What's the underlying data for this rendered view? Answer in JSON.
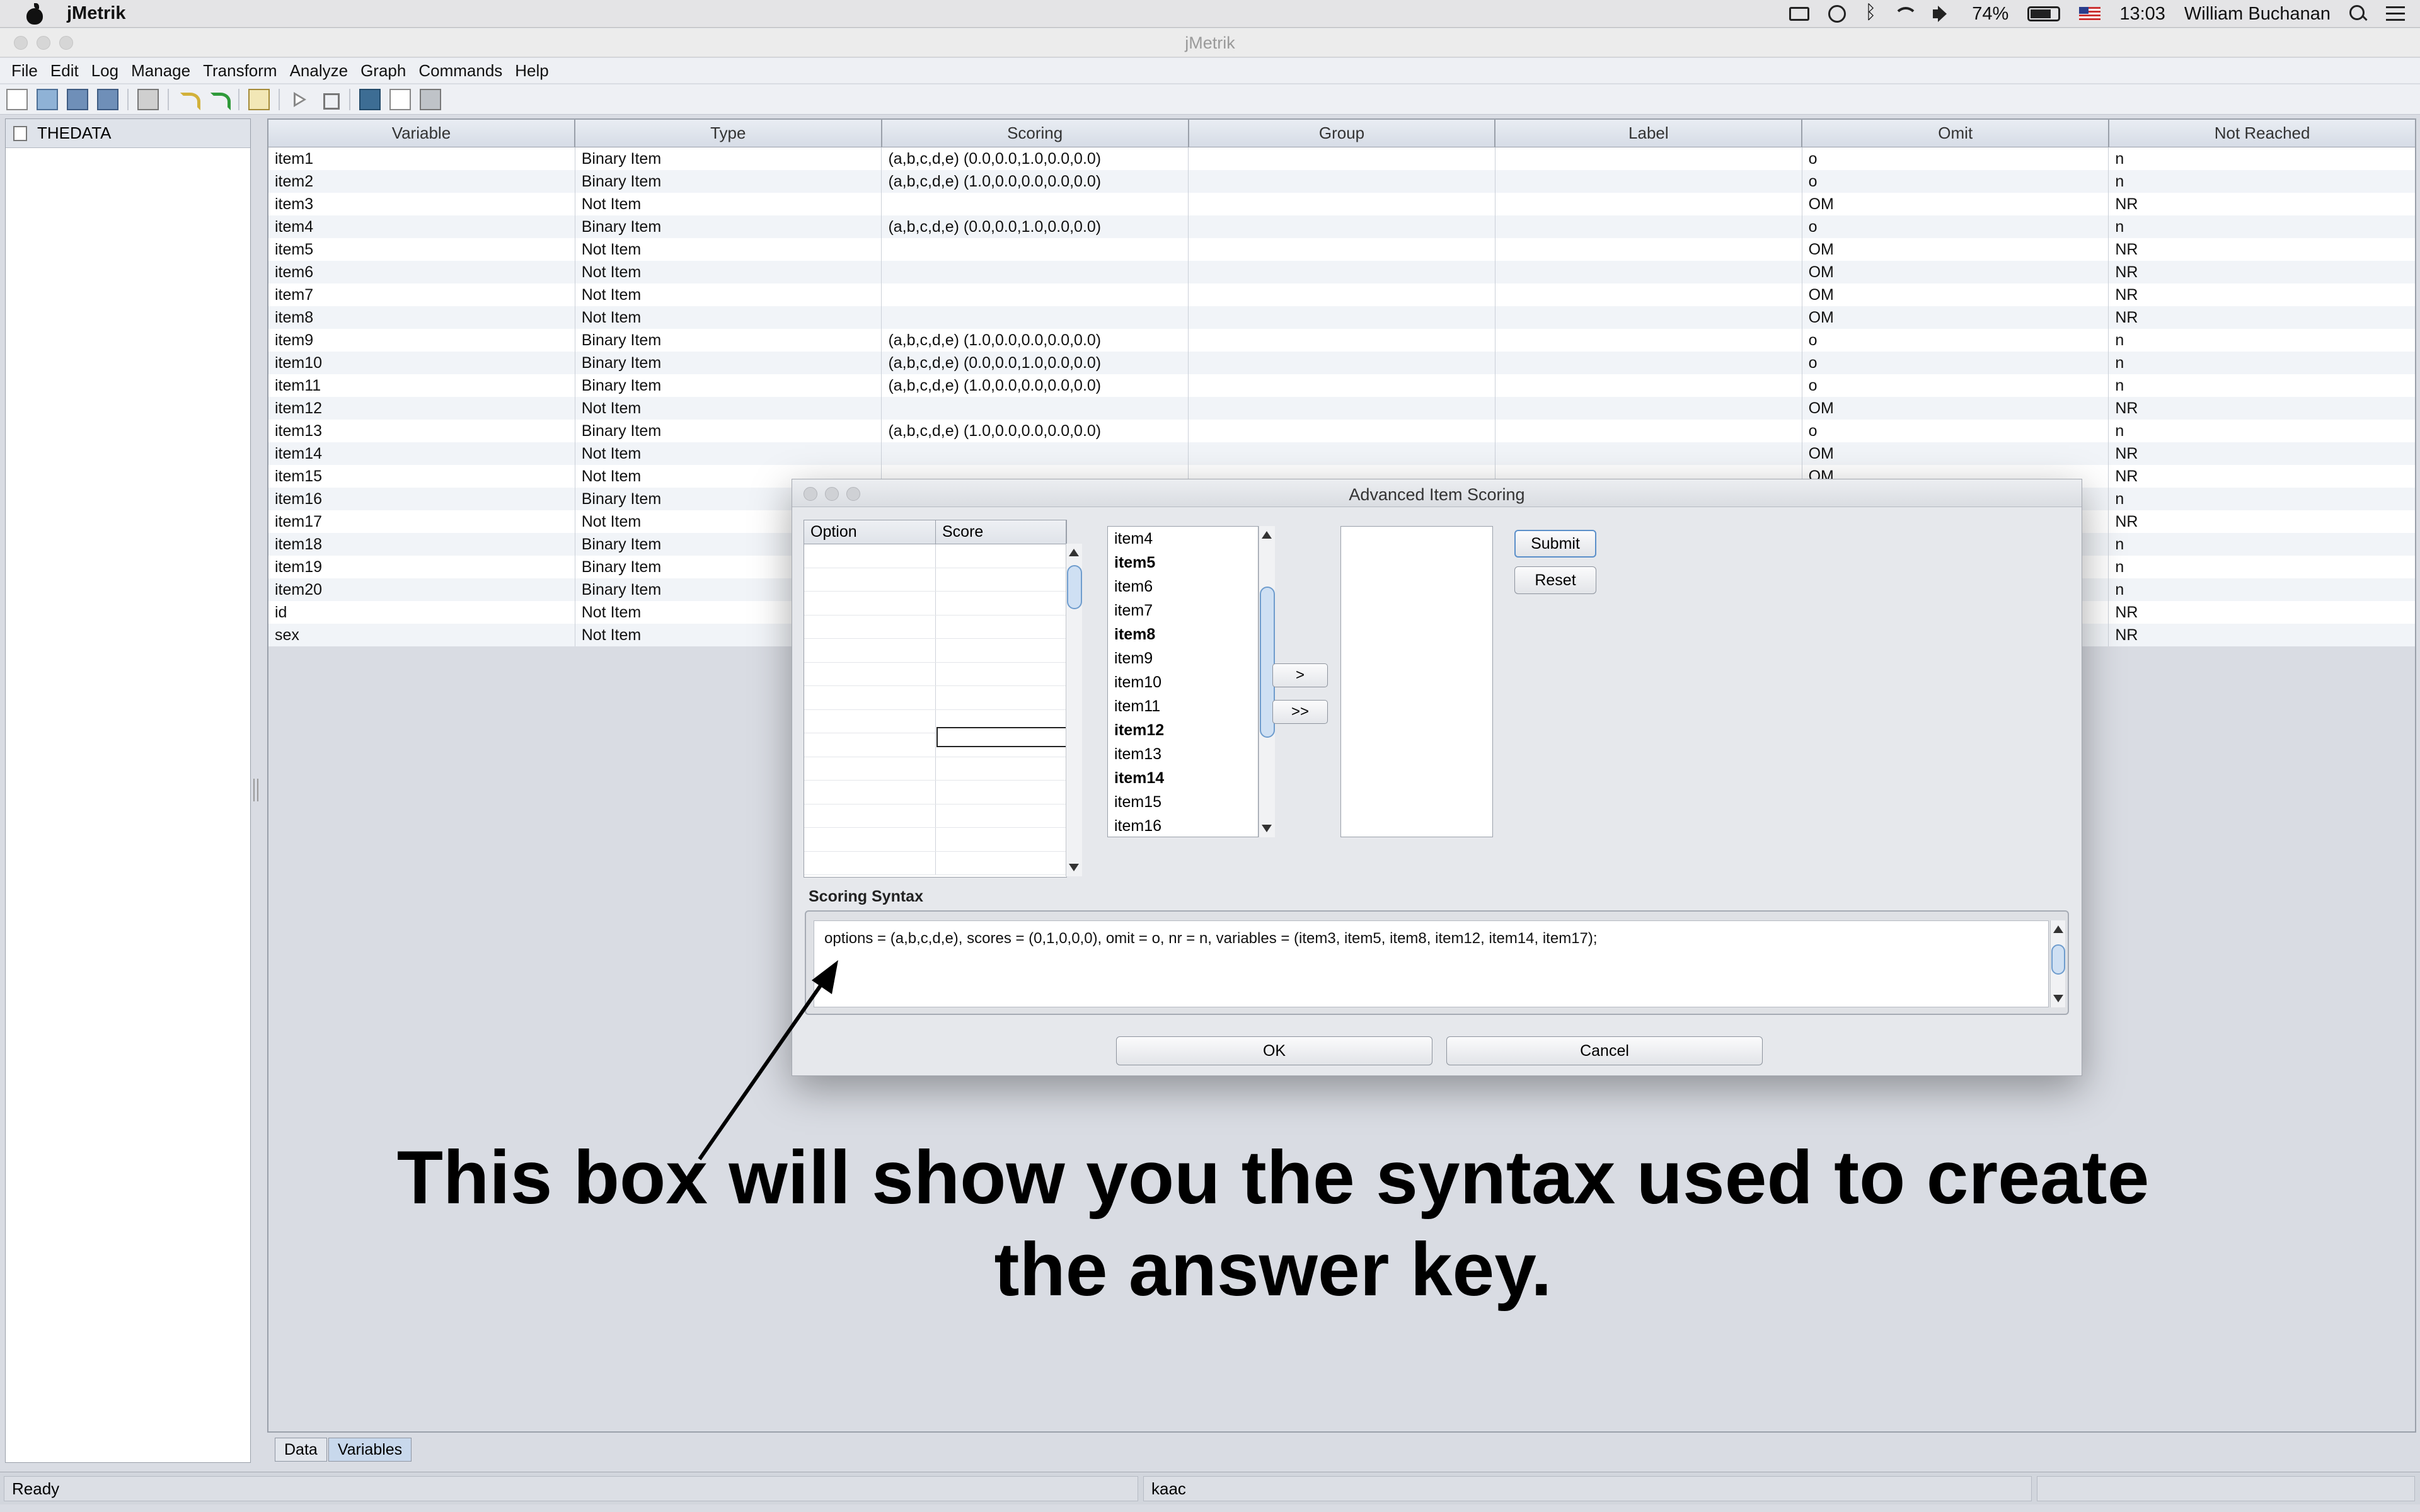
{
  "os_menubar": {
    "app_name": "jMetrik",
    "battery": "74%",
    "time": "13:03",
    "user": "William Buchanan"
  },
  "window": {
    "title": "jMetrik"
  },
  "menu": [
    "File",
    "Edit",
    "Log",
    "Manage",
    "Transform",
    "Analyze",
    "Graph",
    "Commands",
    "Help"
  ],
  "tree": {
    "root": "THEDATA"
  },
  "table": {
    "columns": [
      "Variable",
      "Type",
      "Scoring",
      "Group",
      "Label",
      "Omit",
      "Not Reached"
    ],
    "rows": [
      [
        "item1",
        "Binary Item",
        "(a,b,c,d,e) (0.0,0.0,1.0,0.0,0.0)",
        "",
        "",
        "o",
        "n"
      ],
      [
        "item2",
        "Binary Item",
        "(a,b,c,d,e) (1.0,0.0,0.0,0.0,0.0)",
        "",
        "",
        "o",
        "n"
      ],
      [
        "item3",
        "Not Item",
        "",
        "",
        "",
        "OM",
        "NR"
      ],
      [
        "item4",
        "Binary Item",
        "(a,b,c,d,e) (0.0,0.0,1.0,0.0,0.0)",
        "",
        "",
        "o",
        "n"
      ],
      [
        "item5",
        "Not Item",
        "",
        "",
        "",
        "OM",
        "NR"
      ],
      [
        "item6",
        "Not Item",
        "",
        "",
        "",
        "OM",
        "NR"
      ],
      [
        "item7",
        "Not Item",
        "",
        "",
        "",
        "OM",
        "NR"
      ],
      [
        "item8",
        "Not Item",
        "",
        "",
        "",
        "OM",
        "NR"
      ],
      [
        "item9",
        "Binary Item",
        "(a,b,c,d,e) (1.0,0.0,0.0,0.0,0.0)",
        "",
        "",
        "o",
        "n"
      ],
      [
        "item10",
        "Binary Item",
        "(a,b,c,d,e) (0.0,0.0,1.0,0.0,0.0)",
        "",
        "",
        "o",
        "n"
      ],
      [
        "item11",
        "Binary Item",
        "(a,b,c,d,e) (1.0,0.0,0.0,0.0,0.0)",
        "",
        "",
        "o",
        "n"
      ],
      [
        "item12",
        "Not Item",
        "",
        "",
        "",
        "OM",
        "NR"
      ],
      [
        "item13",
        "Binary Item",
        "(a,b,c,d,e) (1.0,0.0,0.0,0.0,0.0)",
        "",
        "",
        "o",
        "n"
      ],
      [
        "item14",
        "Not Item",
        "",
        "",
        "",
        "OM",
        "NR"
      ],
      [
        "item15",
        "Not Item",
        "",
        "",
        "",
        "OM",
        "NR"
      ],
      [
        "item16",
        "Binary Item",
        "",
        "",
        "",
        "",
        "n"
      ],
      [
        "item17",
        "Not Item",
        "",
        "",
        "",
        "",
        "NR"
      ],
      [
        "item18",
        "Binary Item",
        "",
        "",
        "",
        "",
        "n"
      ],
      [
        "item19",
        "Binary Item",
        "",
        "",
        "",
        "",
        "n"
      ],
      [
        "item20",
        "Binary Item",
        "",
        "",
        "",
        "",
        "n"
      ],
      [
        "id",
        "Not Item",
        "",
        "",
        "",
        "",
        "NR"
      ],
      [
        "sex",
        "Not Item",
        "",
        "",
        "",
        "",
        "NR"
      ]
    ]
  },
  "tabs": [
    "Data",
    "Variables"
  ],
  "active_tab": "Variables",
  "statusbar": {
    "left": "Ready",
    "middle": "kaac"
  },
  "dialog": {
    "title": "Advanced Item Scoring",
    "option_header": "Option",
    "score_header": "Score",
    "items": [
      {
        "label": "item4",
        "bold": false
      },
      {
        "label": "item5",
        "bold": true
      },
      {
        "label": "item6",
        "bold": false
      },
      {
        "label": "item7",
        "bold": false
      },
      {
        "label": "item8",
        "bold": true
      },
      {
        "label": "item9",
        "bold": false
      },
      {
        "label": "item10",
        "bold": false
      },
      {
        "label": "item11",
        "bold": false
      },
      {
        "label": "item12",
        "bold": true
      },
      {
        "label": "item13",
        "bold": false
      },
      {
        "label": "item14",
        "bold": true
      },
      {
        "label": "item15",
        "bold": false
      },
      {
        "label": "item16",
        "bold": false
      }
    ],
    "move_one": ">",
    "move_all": ">>",
    "submit": "Submit",
    "reset": "Reset",
    "syntax_label": "Scoring Syntax",
    "syntax_text": "options = (a,b,c,d,e), scores = (0,1,0,0,0), omit = o, nr = n, variables = (item3, item5, item8, item12, item14, item17);",
    "ok": "OK",
    "cancel": "Cancel"
  },
  "annotation": {
    "line1": "This box will show you the syntax used to create",
    "line2": "the answer key."
  }
}
